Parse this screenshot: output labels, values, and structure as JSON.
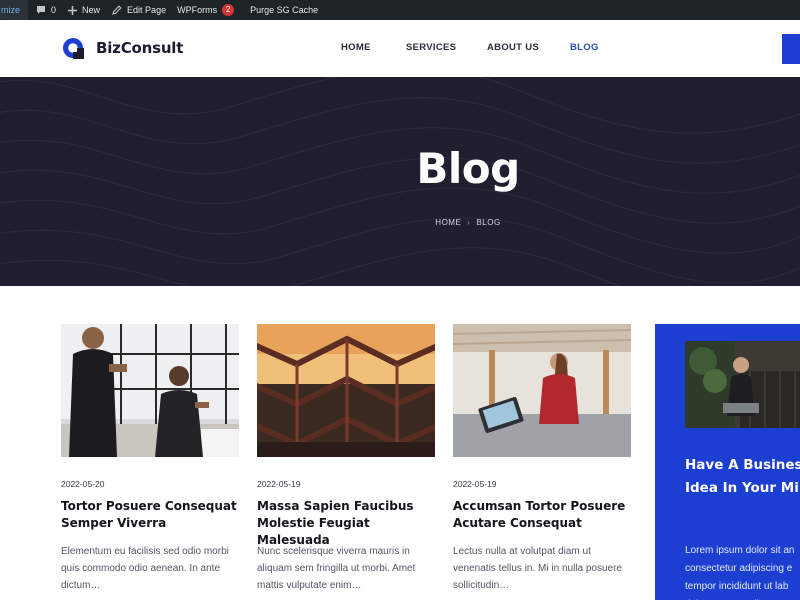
{
  "admin_bar": {
    "customize_label": "mize",
    "comments_count": "0",
    "new_label": "New",
    "edit_page_label": "Edit Page",
    "wpforms_label": "WPForms",
    "wpforms_badge": "2",
    "purge_label": "Purge SG Cache"
  },
  "header": {
    "logo_text": "BizConsult",
    "nav": [
      {
        "label": "HOME"
      },
      {
        "label": "SERVICES"
      },
      {
        "label": "ABOUT US"
      },
      {
        "label": "BLOG",
        "active": true
      }
    ],
    "accent_color": "#1d3fd1"
  },
  "hero": {
    "title": "Blog",
    "breadcrumb": {
      "home": "HOME",
      "separator": "›",
      "current": "BLOG"
    },
    "background_color": "#1f1f2f"
  },
  "posts": [
    {
      "image": "office-meeting-photo",
      "date": "2022-05-20",
      "title": "Tortor Posuere Consequat Semper Viverra",
      "excerpt": "Elementum eu facilisis sed odio morbi quis commodo odio aenean. In ante dictum…"
    },
    {
      "image": "stairway-structure-photo",
      "date": "2022-05-19",
      "title": "Massa Sapien Faucibus Molestie Feugiat Malesuada",
      "excerpt": "Nunc scelerisque viverra mauris in aliquam sem fringilla ut morbi. Amet mattis vulputate enim…"
    },
    {
      "image": "cafe-cashier-photo",
      "date": "2022-05-19",
      "title": "Accumsan Tortor Posuere Acutare Consequat",
      "excerpt": "Lectus nulla at volutpat diam ut venenatis tellus in. Mi in nulla posuere sollicitudin…"
    }
  ],
  "promo": {
    "image": "woman-laptop-photo",
    "title": "Have A Busines\nIdea In Your Mi",
    "text": "Lorem ipsum dolor sit an\nconsectetur adipiscing e\ntempor incididunt ut lab\ndolore magna aliqua."
  }
}
